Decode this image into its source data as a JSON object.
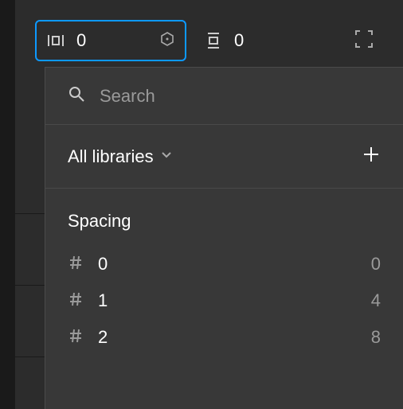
{
  "fields": {
    "horizontal_gap": "0",
    "vertical_gap": "0"
  },
  "search": {
    "placeholder": "Search"
  },
  "libraries": {
    "label": "All libraries"
  },
  "section": {
    "title": "Spacing"
  },
  "spacing": [
    {
      "name": "0",
      "value": "0"
    },
    {
      "name": "1",
      "value": "4"
    },
    {
      "name": "2",
      "value": "8"
    }
  ]
}
